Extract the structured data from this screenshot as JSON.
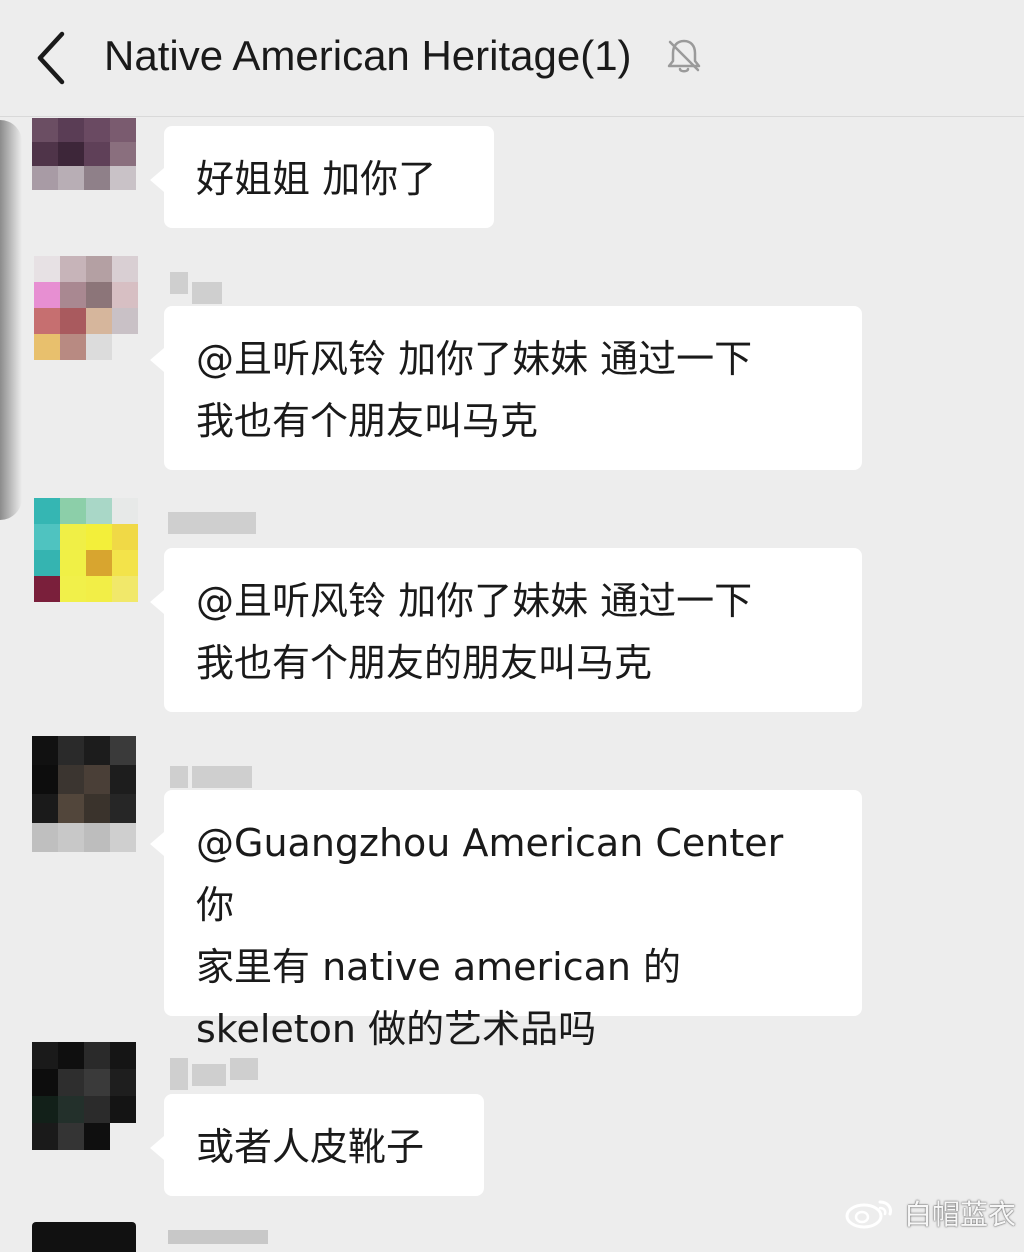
{
  "header": {
    "title": "Native American Heritage(1)",
    "back_icon": "chevron-left-icon",
    "mute_icon": "bell-muted-icon"
  },
  "messages": [
    {
      "text": "好姐姐 加你了",
      "avatar_colors": [
        "#6b4e63",
        "#5a3d55",
        "#6a4a62",
        "#7a5b6f",
        "#4f3449",
        "#3d2639",
        "#5f4058",
        "#8a6f7e",
        "#a89ba5",
        "#b8aeb5",
        "#8f8089",
        "#c9c2c7",
        "#ededed",
        "#ededed",
        "#ededed",
        "#ededed"
      ]
    },
    {
      "text": "@且听风铃 加你了妹妹 通过一下\n我也有个朋友叫马克",
      "avatar_colors": [
        "#e7e1e4",
        "#c7b4b9",
        "#b4a0a3",
        "#d9cfd3",
        "#e78fd2",
        "#a98891",
        "#8c7579",
        "#d7bfc3",
        "#c66f70",
        "#a95a5e",
        "#d6b69c",
        "#c9c1c6",
        "#e8c06d",
        "#b88a82",
        "#dcdcdc",
        "#ededed"
      ]
    },
    {
      "text": "@且听风铃 加你了妹妹 通过一下\n我也有个朋友的朋友叫马克",
      "avatar_colors": [
        "#35b6b3",
        "#8ccfa9",
        "#a9d7c7",
        "#e7e9e8",
        "#4fc3c0",
        "#f0ef46",
        "#f3ef3a",
        "#f0d946",
        "#35b4b1",
        "#f0f046",
        "#d8a52f",
        "#f3e34a",
        "#7a1f3b",
        "#f1f04a",
        "#f2ee47",
        "#f1e86a"
      ]
    },
    {
      "text": "@Guangzhou American Center 你\n家里有 native american 的\nskeleton 做的艺术品吗",
      "avatar_colors": [
        "#111111",
        "#2a2a2a",
        "#1c1c1c",
        "#3a3a3a",
        "#0d0d0d",
        "#3b3530",
        "#4a3f37",
        "#1d1d1d",
        "#1a1a1a",
        "#52463b",
        "#3a332c",
        "#262626",
        "#bfbfbf",
        "#c8c8c8",
        "#bdbdbd",
        "#cfcfcf"
      ]
    },
    {
      "text": "或者人皮靴子",
      "avatar_colors": [
        "#1a1a1a",
        "#0f0f0f",
        "#2a2a2a",
        "#151515",
        "#0d0d0d",
        "#2e2e2e",
        "#3a3a3a",
        "#1e1e1e",
        "#122019",
        "#23302b",
        "#2b2b2b",
        "#141414",
        "#1a1a1a",
        "#343434",
        "#0f0f0f",
        "#ededed"
      ]
    }
  ],
  "watermark": {
    "text": "白帽蓝衣",
    "logo_icon": "weibo-logo-icon"
  }
}
